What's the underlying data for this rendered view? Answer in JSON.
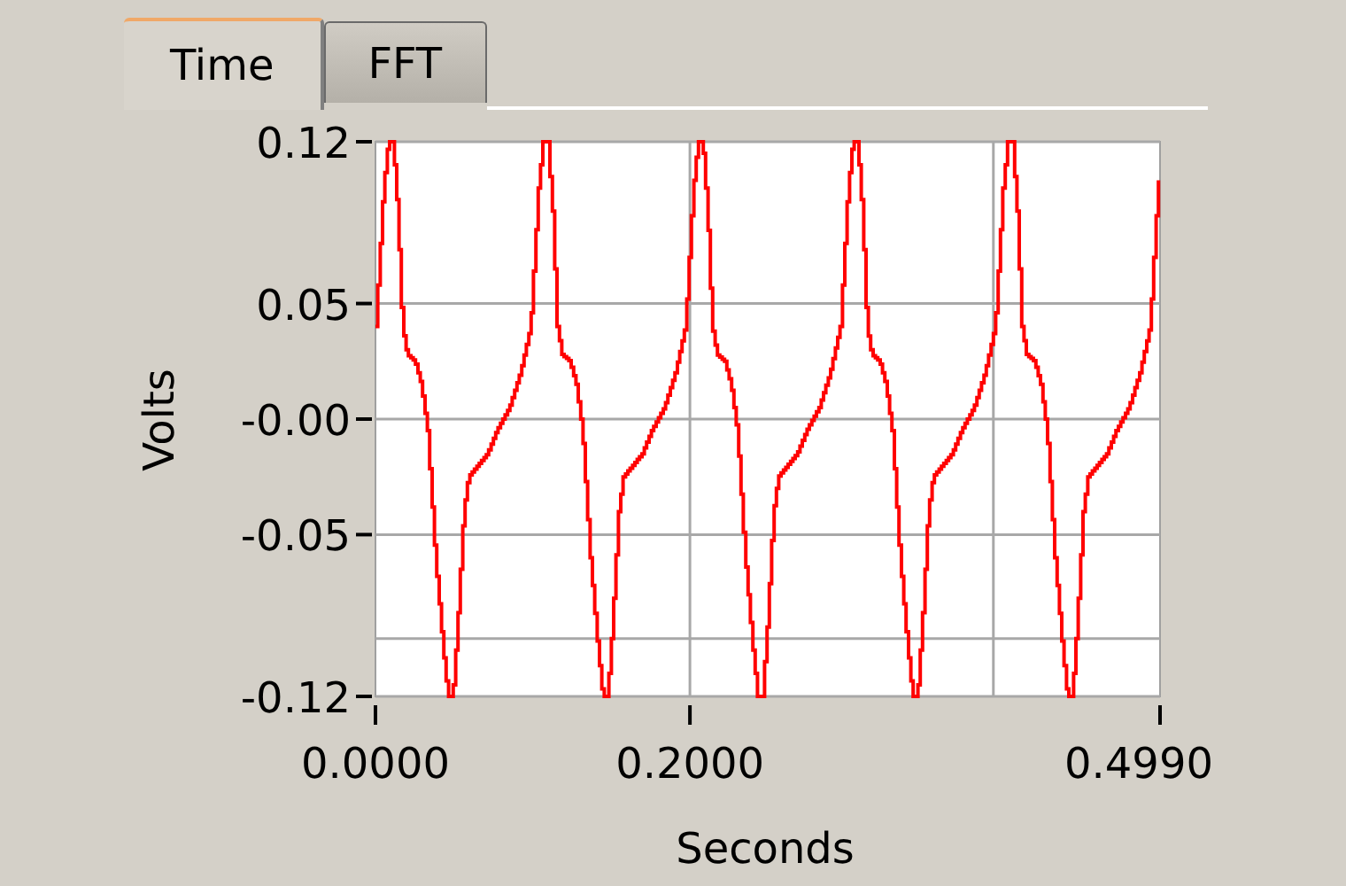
{
  "tabs": [
    {
      "label": "Time",
      "selected": true
    },
    {
      "label": "FFT",
      "selected": false
    }
  ],
  "plot": {
    "ylabel": "Volts",
    "xlabel": "Seconds",
    "yticks": [
      "0.12",
      "0.05",
      "-0.00",
      "-0.05",
      "-0.12"
    ],
    "xticks": [
      "0.0000",
      "0.2000",
      "0.4990"
    ]
  }
}
